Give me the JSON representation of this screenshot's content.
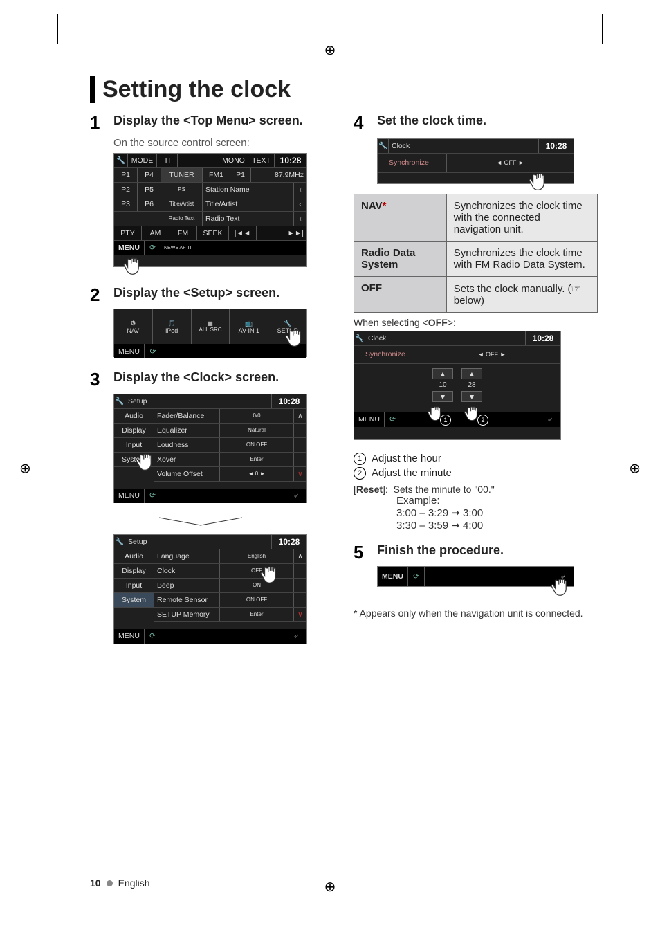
{
  "page": {
    "title": "Setting the clock",
    "footer_page": "10",
    "footer_lang": "English"
  },
  "left": {
    "step1": {
      "num": "1",
      "title": "Display the <Top Menu> screen.",
      "sub": "On the source control screen:"
    },
    "radio_screen": {
      "top": {
        "mode": "MODE",
        "ti": "TI",
        "mono": "MONO",
        "text": "TEXT",
        "clock": "10:28"
      },
      "presets": [
        "P1",
        "P2",
        "P3",
        "P4",
        "P5",
        "P6"
      ],
      "tuner": "TUNER",
      "fm": "FM1",
      "preset_ind": "P1",
      "freq": "87.9MHz",
      "ps": "PS",
      "sn": "Station Name",
      "ta": "Title/Artist",
      "ta_lbl": "Title/Artist",
      "rt": "Radio Text",
      "rt_lbl": "Radio Text",
      "bottom": {
        "pty": "PTY",
        "am": "AM",
        "fmbtn": "FM",
        "seek": "SEEK"
      },
      "menu": "MENU",
      "news": "NEWS   AF   TI"
    },
    "step2": {
      "num": "2",
      "title": "Display the <Setup> screen."
    },
    "nav_screen": {
      "items": [
        "NAV",
        "iPod",
        "ALL SRC",
        "",
        "AV-IN 1",
        "SETUP"
      ],
      "menu": "MENU"
    },
    "step3": {
      "num": "3",
      "title": "Display the <Clock> screen."
    },
    "setup1": {
      "label": "Setup",
      "clock": "10:28",
      "tabs": [
        "Audio",
        "Display",
        "Input",
        "System"
      ],
      "rows": [
        {
          "l": "Fader/Balance",
          "r": "0/0"
        },
        {
          "l": "Equalizer",
          "r": "Natural"
        },
        {
          "l": "Loudness",
          "r": "ON    OFF"
        },
        {
          "l": "Xover",
          "r": "Enter"
        },
        {
          "l": "Volume Offset",
          "r": "◄   0   ►"
        }
      ],
      "menu": "MENU"
    },
    "setup2": {
      "label": "Setup",
      "clock": "10:28",
      "tabs": [
        "Audio",
        "Display",
        "Input",
        "System"
      ],
      "rows": [
        {
          "l": "Language",
          "r": "English"
        },
        {
          "l": "Clock",
          "r": "OFF"
        },
        {
          "l": "Beep",
          "r": "ON"
        },
        {
          "l": "Remote Sensor",
          "r": "ON    OFF"
        },
        {
          "l": "SETUP Memory",
          "r": "Enter"
        }
      ],
      "menu": "MENU"
    }
  },
  "right": {
    "step4": {
      "num": "4",
      "title": "Set the clock time."
    },
    "sync1": {
      "label": "Clock",
      "clock": "10:28",
      "row": "Synchronize",
      "val": "◄     OFF     ►"
    },
    "table": [
      {
        "k": "NAV*",
        "v": "Synchronizes the clock time with the connected navigation unit."
      },
      {
        "k": "Radio Data System",
        "v": "Synchronizes the clock time with FM Radio Data System."
      },
      {
        "k": "OFF",
        "v": "Sets the clock manually. (☞ below)"
      }
    ],
    "when_off": "When selecting <OFF>:",
    "sync2": {
      "label": "Clock",
      "clock": "10:28",
      "row": "Synchronize",
      "val": "◄     OFF     ►",
      "h": "10",
      "m": "28",
      "menu": "MENU"
    },
    "adj1": "Adjust the hour",
    "adj2": "Adjust the minute",
    "reset_label": "[Reset]:",
    "reset_text": "Sets the minute to \"00.\"",
    "example": "Example:",
    "ex1a": "3:00 – 3:29",
    "ex1b": "3:00",
    "ex2a": "3:30 – 3:59",
    "ex2b": "4:00",
    "step5": {
      "num": "5",
      "title": "Finish the procedure."
    },
    "finish": {
      "menu": "MENU"
    },
    "footnote": "*  Appears only when the navigation unit is connected."
  }
}
